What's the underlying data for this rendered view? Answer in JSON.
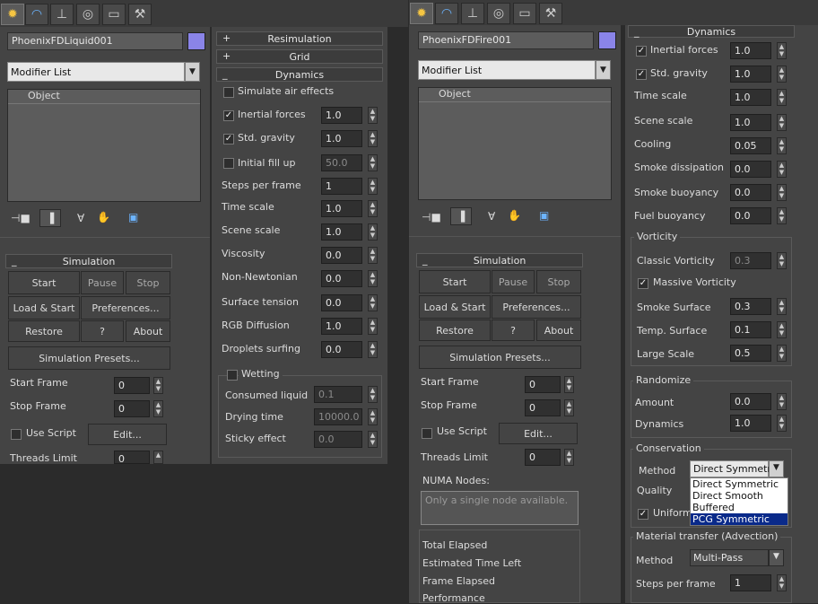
{
  "tabs": [
    {
      "icon": "create-icon",
      "glyph": "✹"
    },
    {
      "icon": "modify-icon",
      "glyph": "◠"
    },
    {
      "icon": "hierarchy-icon",
      "glyph": "⊥"
    },
    {
      "icon": "motion-icon",
      "glyph": "◎"
    },
    {
      "icon": "display-icon",
      "glyph": "▭"
    },
    {
      "icon": "utilities-icon",
      "glyph": "⚒"
    }
  ],
  "left": {
    "object_name": "PhoenixFDLiquid001",
    "color_swatch": "#8a84e8",
    "modifier_list": "Modifier List",
    "stack_item": "Object",
    "simulation": {
      "title": "Simulation",
      "start": "Start",
      "pause": "Pause",
      "stop": "Stop",
      "load_start": "Load & Start",
      "preferences": "Preferences...",
      "restore": "Restore",
      "help": "?",
      "about": "About",
      "presets": "Simulation Presets...",
      "start_frame_label": "Start Frame",
      "start_frame": "0",
      "stop_frame_label": "Stop Frame",
      "stop_frame": "0",
      "use_script": "Use Script",
      "edit": "Edit...",
      "threads_label": "Threads Limit",
      "threads": "0"
    },
    "rollouts": {
      "resimulation": "Resimulation",
      "grid": "Grid",
      "dynamics": "Dynamics"
    },
    "dynamics": {
      "simulate_air": "Simulate air effects",
      "inertial_forces": "Inertial forces",
      "inertial_forces_val": "1.0",
      "std_gravity": "Std. gravity",
      "std_gravity_val": "1.0",
      "initial_fill": "Initial fill up",
      "initial_fill_val": "50.0",
      "steps_per_frame": "Steps per frame",
      "steps_per_frame_val": "1",
      "time_scale": "Time scale",
      "time_scale_val": "1.0",
      "scene_scale": "Scene scale",
      "scene_scale_val": "1.0",
      "viscosity": "Viscosity",
      "viscosity_val": "0.0",
      "non_newtonian": "Non-Newtonian",
      "non_newtonian_val": "0.0",
      "surface_tension": "Surface tension",
      "surface_tension_val": "0.0",
      "rgb_diffusion": "RGB Diffusion",
      "rgb_diffusion_val": "1.0",
      "droplets_surfing": "Droplets surfing",
      "droplets_surfing_val": "0.0",
      "wetting": "Wetting",
      "consumed_liquid": "Consumed liquid",
      "consumed_liquid_val": "0.1",
      "drying_time": "Drying time",
      "drying_time_val": "10000.0",
      "sticky_effect": "Sticky effect",
      "sticky_effect_val": "0.0"
    }
  },
  "right": {
    "object_name": "PhoenixFDFire001",
    "color_swatch": "#8a84e8",
    "modifier_list": "Modifier List",
    "stack_item": "Object",
    "simulation": {
      "title": "Simulation",
      "start": "Start",
      "pause": "Pause",
      "stop": "Stop",
      "load_start": "Load & Start",
      "preferences": "Preferences...",
      "restore": "Restore",
      "help": "?",
      "about": "About",
      "presets": "Simulation Presets...",
      "start_frame_label": "Start Frame",
      "start_frame": "0",
      "stop_frame_label": "Stop Frame",
      "stop_frame": "0",
      "use_script": "Use Script",
      "edit": "Edit...",
      "threads_label": "Threads Limit",
      "threads": "0",
      "numa_label": "NUMA Nodes:",
      "numa_placeholder": "Only a single node available.",
      "total_elapsed": "Total Elapsed",
      "time_left": "Estimated Time Left",
      "frame_elapsed": "Frame Elapsed",
      "performance": "Performance"
    },
    "dynamics": {
      "title": "Dynamics",
      "inertial_forces": "Inertial forces",
      "inertial_forces_val": "1.0",
      "std_gravity": "Std. gravity",
      "std_gravity_val": "1.0",
      "time_scale": "Time scale",
      "time_scale_val": "1.0",
      "scene_scale": "Scene scale",
      "scene_scale_val": "1.0",
      "cooling": "Cooling",
      "cooling_val": "0.05",
      "smoke_dissipation": "Smoke dissipation",
      "smoke_dissipation_val": "0.0",
      "smoke_buoyancy": "Smoke buoyancy",
      "smoke_buoyancy_val": "0.0",
      "fuel_buoyancy": "Fuel buoyancy",
      "fuel_buoyancy_val": "0.0"
    },
    "vorticity": {
      "title": "Vorticity",
      "classic": "Classic Vorticity",
      "classic_val": "0.3",
      "massive": "Massive Vorticity",
      "smoke_surface": "Smoke Surface",
      "smoke_surface_val": "0.3",
      "temp_surface": "Temp. Surface",
      "temp_surface_val": "0.1",
      "large_scale": "Large Scale",
      "large_scale_val": "0.5"
    },
    "randomize": {
      "title": "Randomize",
      "amount": "Amount",
      "amount_val": "0.0",
      "dynamics": "Dynamics",
      "dynamics_val": "1.0"
    },
    "conservation": {
      "title": "Conservation",
      "method_label": "Method",
      "method_value": "Direct Symmetric",
      "quality_label": "Quality",
      "uniform_label": "Uniform",
      "options": [
        "Direct Symmetric",
        "Direct Smooth",
        "Buffered",
        "PCG Symmetric"
      ],
      "highlighted": "PCG Symmetric"
    },
    "material_transfer": {
      "title": "Material transfer (Advection)",
      "method_label": "Method",
      "method_value": "Multi-Pass",
      "steps_label": "Steps per frame",
      "steps_val": "1"
    }
  }
}
